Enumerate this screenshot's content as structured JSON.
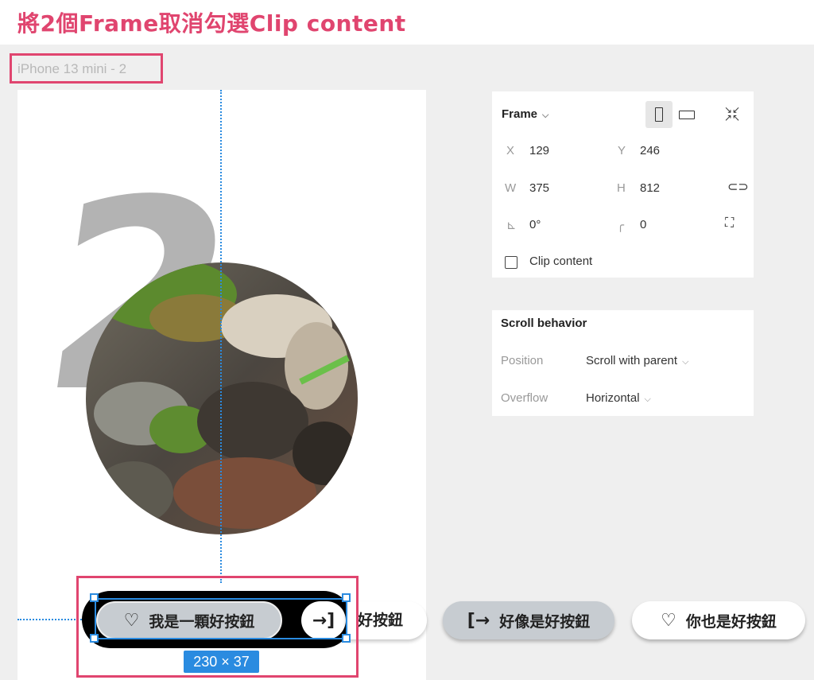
{
  "title": "將2個Frame取消勾選Clip content",
  "frame_label": "iPhone 13 mini - 2",
  "big_numeral": "2",
  "inspector": {
    "frame_dropdown": "Frame",
    "x_label": "X",
    "x_value": "129",
    "y_label": "Y",
    "y_value": "246",
    "w_label": "W",
    "w_value": "375",
    "h_label": "H",
    "h_value": "812",
    "rotation_value": "0°",
    "radius_value": "0",
    "clip_content_label": "Clip content",
    "clip_content_checked": false
  },
  "scroll": {
    "heading": "Scroll behavior",
    "position_label": "Position",
    "position_value": "Scroll with parent",
    "overflow_label": "Overflow",
    "overflow_value": "Horizontal"
  },
  "buttons": {
    "b1": "我是一顆好按鈕",
    "b2": "好按鈕",
    "b3": "好像是好按鈕",
    "b4": "你也是好按鈕"
  },
  "selection_size": "230 × 37",
  "colors": {
    "highlight": "#e0456f",
    "selection": "#2a8be0"
  }
}
